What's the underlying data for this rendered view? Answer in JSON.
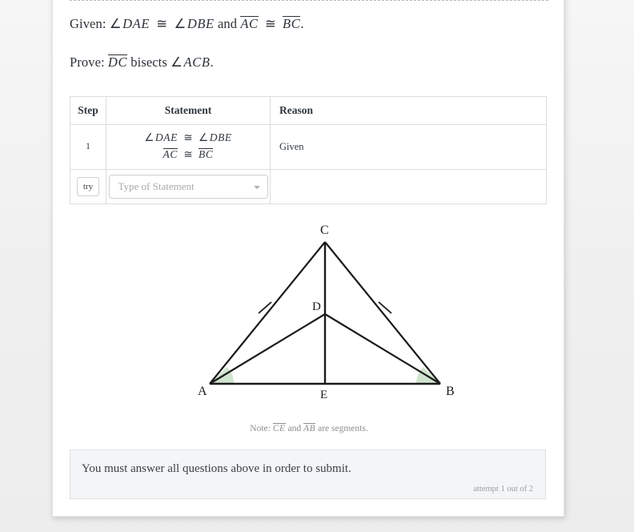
{
  "given": {
    "label": "Given:",
    "angle1": "DAE",
    "angle2": "DBE",
    "conj": "and",
    "seg1": "AC",
    "seg2": "BC",
    "period": "."
  },
  "prove": {
    "label": "Prove:",
    "segment": "DC",
    "verb": "bisects",
    "angle": "ACB",
    "period": "."
  },
  "table": {
    "headers": {
      "step": "Step",
      "statement": "Statement",
      "reason": "Reason"
    },
    "rows": [
      {
        "step": "1",
        "statement_line1_angle1": "DAE",
        "statement_line1_angle2": "DBE",
        "statement_line2_seg1": "AC",
        "statement_line2_seg2": "BC",
        "reason": "Given"
      }
    ],
    "input_row": {
      "try_label": "try",
      "select_placeholder": "Type of Statement",
      "reason": ""
    }
  },
  "diagram": {
    "vertices": {
      "A": "A",
      "B": "B",
      "C": "C",
      "D": "D",
      "E": "E"
    },
    "angle_fill_color": "#cfe3cf",
    "stroke_color": "#1b1b1b",
    "note_prefix": "Note:",
    "note_seg1": "CE",
    "note_conj": "and",
    "note_seg2": "AB",
    "note_suffix": "are segments."
  },
  "alert": {
    "message": "You must answer all questions above in order to submit.",
    "attempt": "attempt 1 out of 2"
  },
  "symbols": {
    "congruent": "≅",
    "angle": "∠"
  }
}
